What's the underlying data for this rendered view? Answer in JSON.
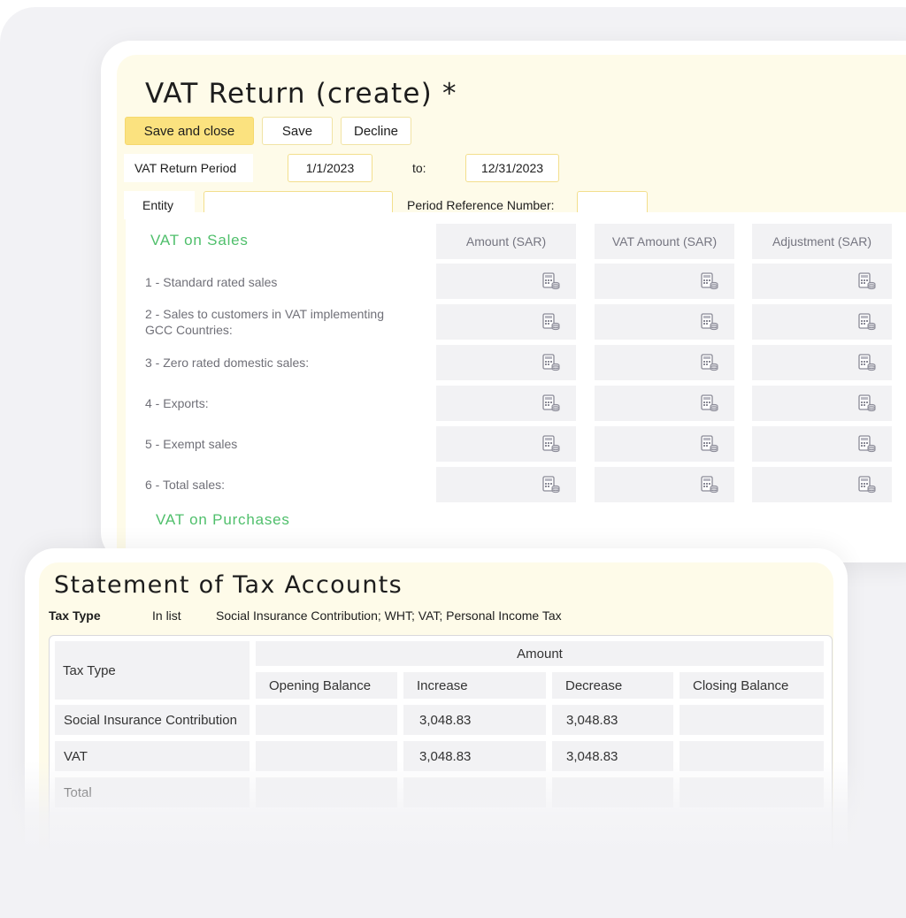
{
  "vat_return": {
    "title": "VAT Return (create) *",
    "buttons": {
      "save_and_close": "Save and close",
      "save": "Save",
      "decline": "Decline"
    },
    "period_label": "VAT Return Period",
    "period_from": "1/1/2023",
    "period_to_label": "to:",
    "period_to": "12/31/2023",
    "entity_label": "Entity",
    "entity_value": "",
    "ref_label": "Period Reference Number:",
    "ref_value": "",
    "sales_heading": "VAT on Sales",
    "purchases_heading": "VAT on Purchases",
    "columns": [
      "Amount (SAR)",
      "VAT Amount (SAR)",
      "Adjustment (SAR)"
    ],
    "rows": [
      "1 - Standard rated sales",
      "2 - Sales to customers in VAT implementing GCC Countries:",
      "3 - Zero rated domestic sales:",
      "4 - Exports:",
      "5 - Exempt sales",
      "6 - Total sales:"
    ],
    "cell_icon": "calculator-icon"
  },
  "statement": {
    "title": "Statement of Tax Accounts",
    "filter_label": "Tax Type",
    "filter_condition": "In list",
    "filter_value": "Social Insurance Contribution; WHT; VAT; Personal Income Tax",
    "header_tax_type": "Tax Type",
    "header_amount": "Amount",
    "sub_headers": [
      "Opening Balance",
      "Increase",
      "Decrease",
      "Closing Balance"
    ],
    "rows": [
      {
        "tax_type": "Social Insurance Contribution",
        "opening": "",
        "increase": "3,048.83",
        "decrease": "3,048.83",
        "closing": ""
      },
      {
        "tax_type": "VAT",
        "opening": "",
        "increase": "3,048.83",
        "decrease": "3,048.83",
        "closing": ""
      },
      {
        "tax_type": "Total",
        "opening": "",
        "increase": "",
        "decrease": "",
        "closing": ""
      }
    ]
  },
  "colors": {
    "accent_yellow": "#fbe27f",
    "panel_cream": "#fefbe9",
    "section_green": "#4fbf6b",
    "cell_gray": "#f2f2f4"
  }
}
